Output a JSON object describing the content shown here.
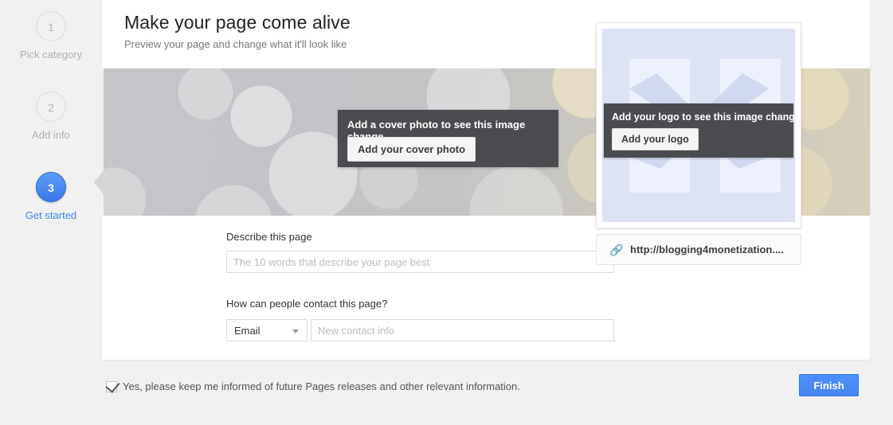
{
  "stepper": {
    "steps": [
      {
        "number": "1",
        "label": "Pick category",
        "active": false
      },
      {
        "number": "2",
        "label": "Add info",
        "active": false
      },
      {
        "number": "3",
        "label": "Get started",
        "active": true
      }
    ]
  },
  "header": {
    "title": "Make your page come alive",
    "subtitle": "Preview your page and change what it'll look like"
  },
  "cover": {
    "overlay_title": "Add a cover photo to see this image change",
    "overlay_button": "Add your cover photo"
  },
  "logo": {
    "overlay_title": "Add your logo to see this image change",
    "overlay_button": "Add your logo",
    "url_icon": "link-icon",
    "url": "http://blogging4monetization...."
  },
  "form": {
    "describe_label": "Describe this page",
    "describe_placeholder": "The 10 words that describe your page best",
    "describe_value": "",
    "contact_label": "How can people contact this page?",
    "contact_type_selected": "Email",
    "contact_type_options": [
      "Email"
    ],
    "contact_placeholder": "New contact info",
    "contact_value": ""
  },
  "footer": {
    "checkbox_checked": true,
    "checkbox_label": "Yes, please keep me informed of future Pages releases and other relevant information.",
    "finish_label": "Finish"
  },
  "colors": {
    "accent_blue": "#4285f4",
    "button_blue": "#4d90fe",
    "overlay_dark": "#4b4c50",
    "page_background": "#f1f1f1",
    "logo_card_background": "#dde3f3"
  }
}
